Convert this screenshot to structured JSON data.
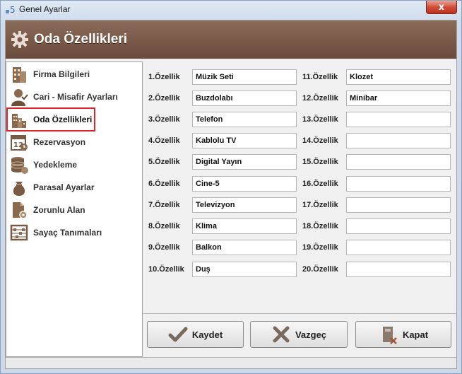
{
  "window": {
    "title": "Genel Ayarlar",
    "close_label": "x"
  },
  "header": {
    "title": "Oda Özellikleri"
  },
  "sidebar": {
    "items": [
      {
        "label": "Firma Bilgileri",
        "icon": "building-icon"
      },
      {
        "label": "Cari - Misafir Ayarları",
        "icon": "user-icon"
      },
      {
        "label": "Oda Özellikleri",
        "icon": "city-icon",
        "selected": true
      },
      {
        "label": "Rezervasyon",
        "icon": "calendar-icon"
      },
      {
        "label": "Yedekleme",
        "icon": "database-icon"
      },
      {
        "label": "Parasal Ayarlar",
        "icon": "money-bag-icon"
      },
      {
        "label": "Zorunlu Alan",
        "icon": "document-gear-icon"
      },
      {
        "label": "Sayaç Tanımaları",
        "icon": "abacus-icon"
      }
    ]
  },
  "features": {
    "left": [
      {
        "label": "1.Özellik",
        "value": "Müzik Seti"
      },
      {
        "label": "2.Özellik",
        "value": "Buzdolabı"
      },
      {
        "label": "3.Özellik",
        "value": "Telefon"
      },
      {
        "label": "4.Özellik",
        "value": "Kablolu TV"
      },
      {
        "label": "5.Özellik",
        "value": "Digital Yayın"
      },
      {
        "label": "6.Özellik",
        "value": "Cine-5"
      },
      {
        "label": "7.Özellik",
        "value": "Televizyon"
      },
      {
        "label": "8.Özellik",
        "value": "Klima"
      },
      {
        "label": "9.Özellik",
        "value": "Balkon"
      },
      {
        "label": "10.Özellik",
        "value": "Duş"
      }
    ],
    "right": [
      {
        "label": "11.Özellik",
        "value": "Klozet"
      },
      {
        "label": "12.Özellik",
        "value": "Minibar"
      },
      {
        "label": "13.Özellik",
        "value": ""
      },
      {
        "label": "14.Özellik",
        "value": ""
      },
      {
        "label": "15.Özellik",
        "value": ""
      },
      {
        "label": "16.Özellik",
        "value": ""
      },
      {
        "label": "17.Özellik",
        "value": ""
      },
      {
        "label": "18.Özellik",
        "value": ""
      },
      {
        "label": "19.Özellik",
        "value": ""
      },
      {
        "label": "20.Özellik",
        "value": ""
      }
    ]
  },
  "buttons": {
    "save": "Kaydet",
    "cancel": "Vazgeç",
    "close": "Kapat"
  },
  "colors": {
    "header_brown": "#6b4b3b",
    "selection_red": "#e0242c"
  }
}
